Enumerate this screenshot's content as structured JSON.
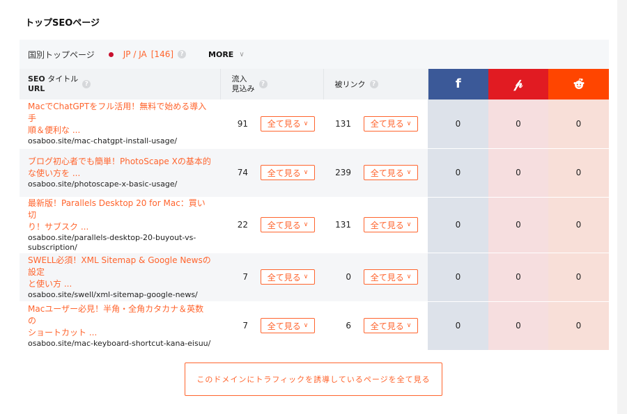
{
  "section_title": "トップSEOページ",
  "filter": {
    "label": "国別トップページ",
    "locale": "JP / JA",
    "count": "[146]",
    "more_label": "MORE",
    "flag_color": "#c8102e"
  },
  "table": {
    "headers": {
      "seo_title": "タイトル",
      "seo_prefix": "SEO",
      "url": "URL",
      "traffic_line1": "流入",
      "traffic_line2": "見込み",
      "backlinks": "被リンク",
      "facebook_icon": "f",
      "pinterest_icon": "𝓅",
      "reddit_icon": "●"
    },
    "view_all_label": "全て見る",
    "rows": [
      {
        "title_line1": "MacでChatGPTをフル活用！無料で始める導入手",
        "title_line2": "順＆便利な ...",
        "url": "osaboo.site/mac-chatgpt-install-usage/",
        "traffic": "91",
        "backlinks": "131",
        "facebook": "0",
        "pinterest": "0",
        "reddit": "0"
      },
      {
        "title_line1": "ブログ初心者でも簡単！PhotoScape Xの基本的",
        "title_line2": "な使い方を ...",
        "url": "osaboo.site/photoscape-x-basic-usage/",
        "traffic": "74",
        "backlinks": "239",
        "facebook": "0",
        "pinterest": "0",
        "reddit": "0"
      },
      {
        "title_line1": "最新版！Parallels Desktop 20 for Mac：買い切",
        "title_line2": "り！サブスク ...",
        "url": "osaboo.site/parallels-desktop-20-buyout-vs-subscription/",
        "traffic": "22",
        "backlinks": "131",
        "facebook": "0",
        "pinterest": "0",
        "reddit": "0"
      },
      {
        "title_line1": "SWELL必須！XML Sitemap & Google Newsの設定",
        "title_line2": "と使い方 ...",
        "url": "osaboo.site/swell/xml-sitemap-google-news/",
        "traffic": "7",
        "backlinks": "0",
        "facebook": "0",
        "pinterest": "0",
        "reddit": "0"
      },
      {
        "title_line1": "Macユーザー必見！半角・全角カタカナ＆英数の",
        "title_line2": "ショートカット ...",
        "url": "osaboo.site/mac-keyboard-shortcut-kana-eisuu/",
        "traffic": "7",
        "backlinks": "6",
        "facebook": "0",
        "pinterest": "0",
        "reddit": "0"
      }
    ]
  },
  "cta_label": "このドメインにトラフィックを誘導しているページを全て見る",
  "colors": {
    "accent": "#ff642d",
    "facebook": "#3b5998",
    "pinterest": "#e11b22",
    "reddit": "#ff4500"
  }
}
